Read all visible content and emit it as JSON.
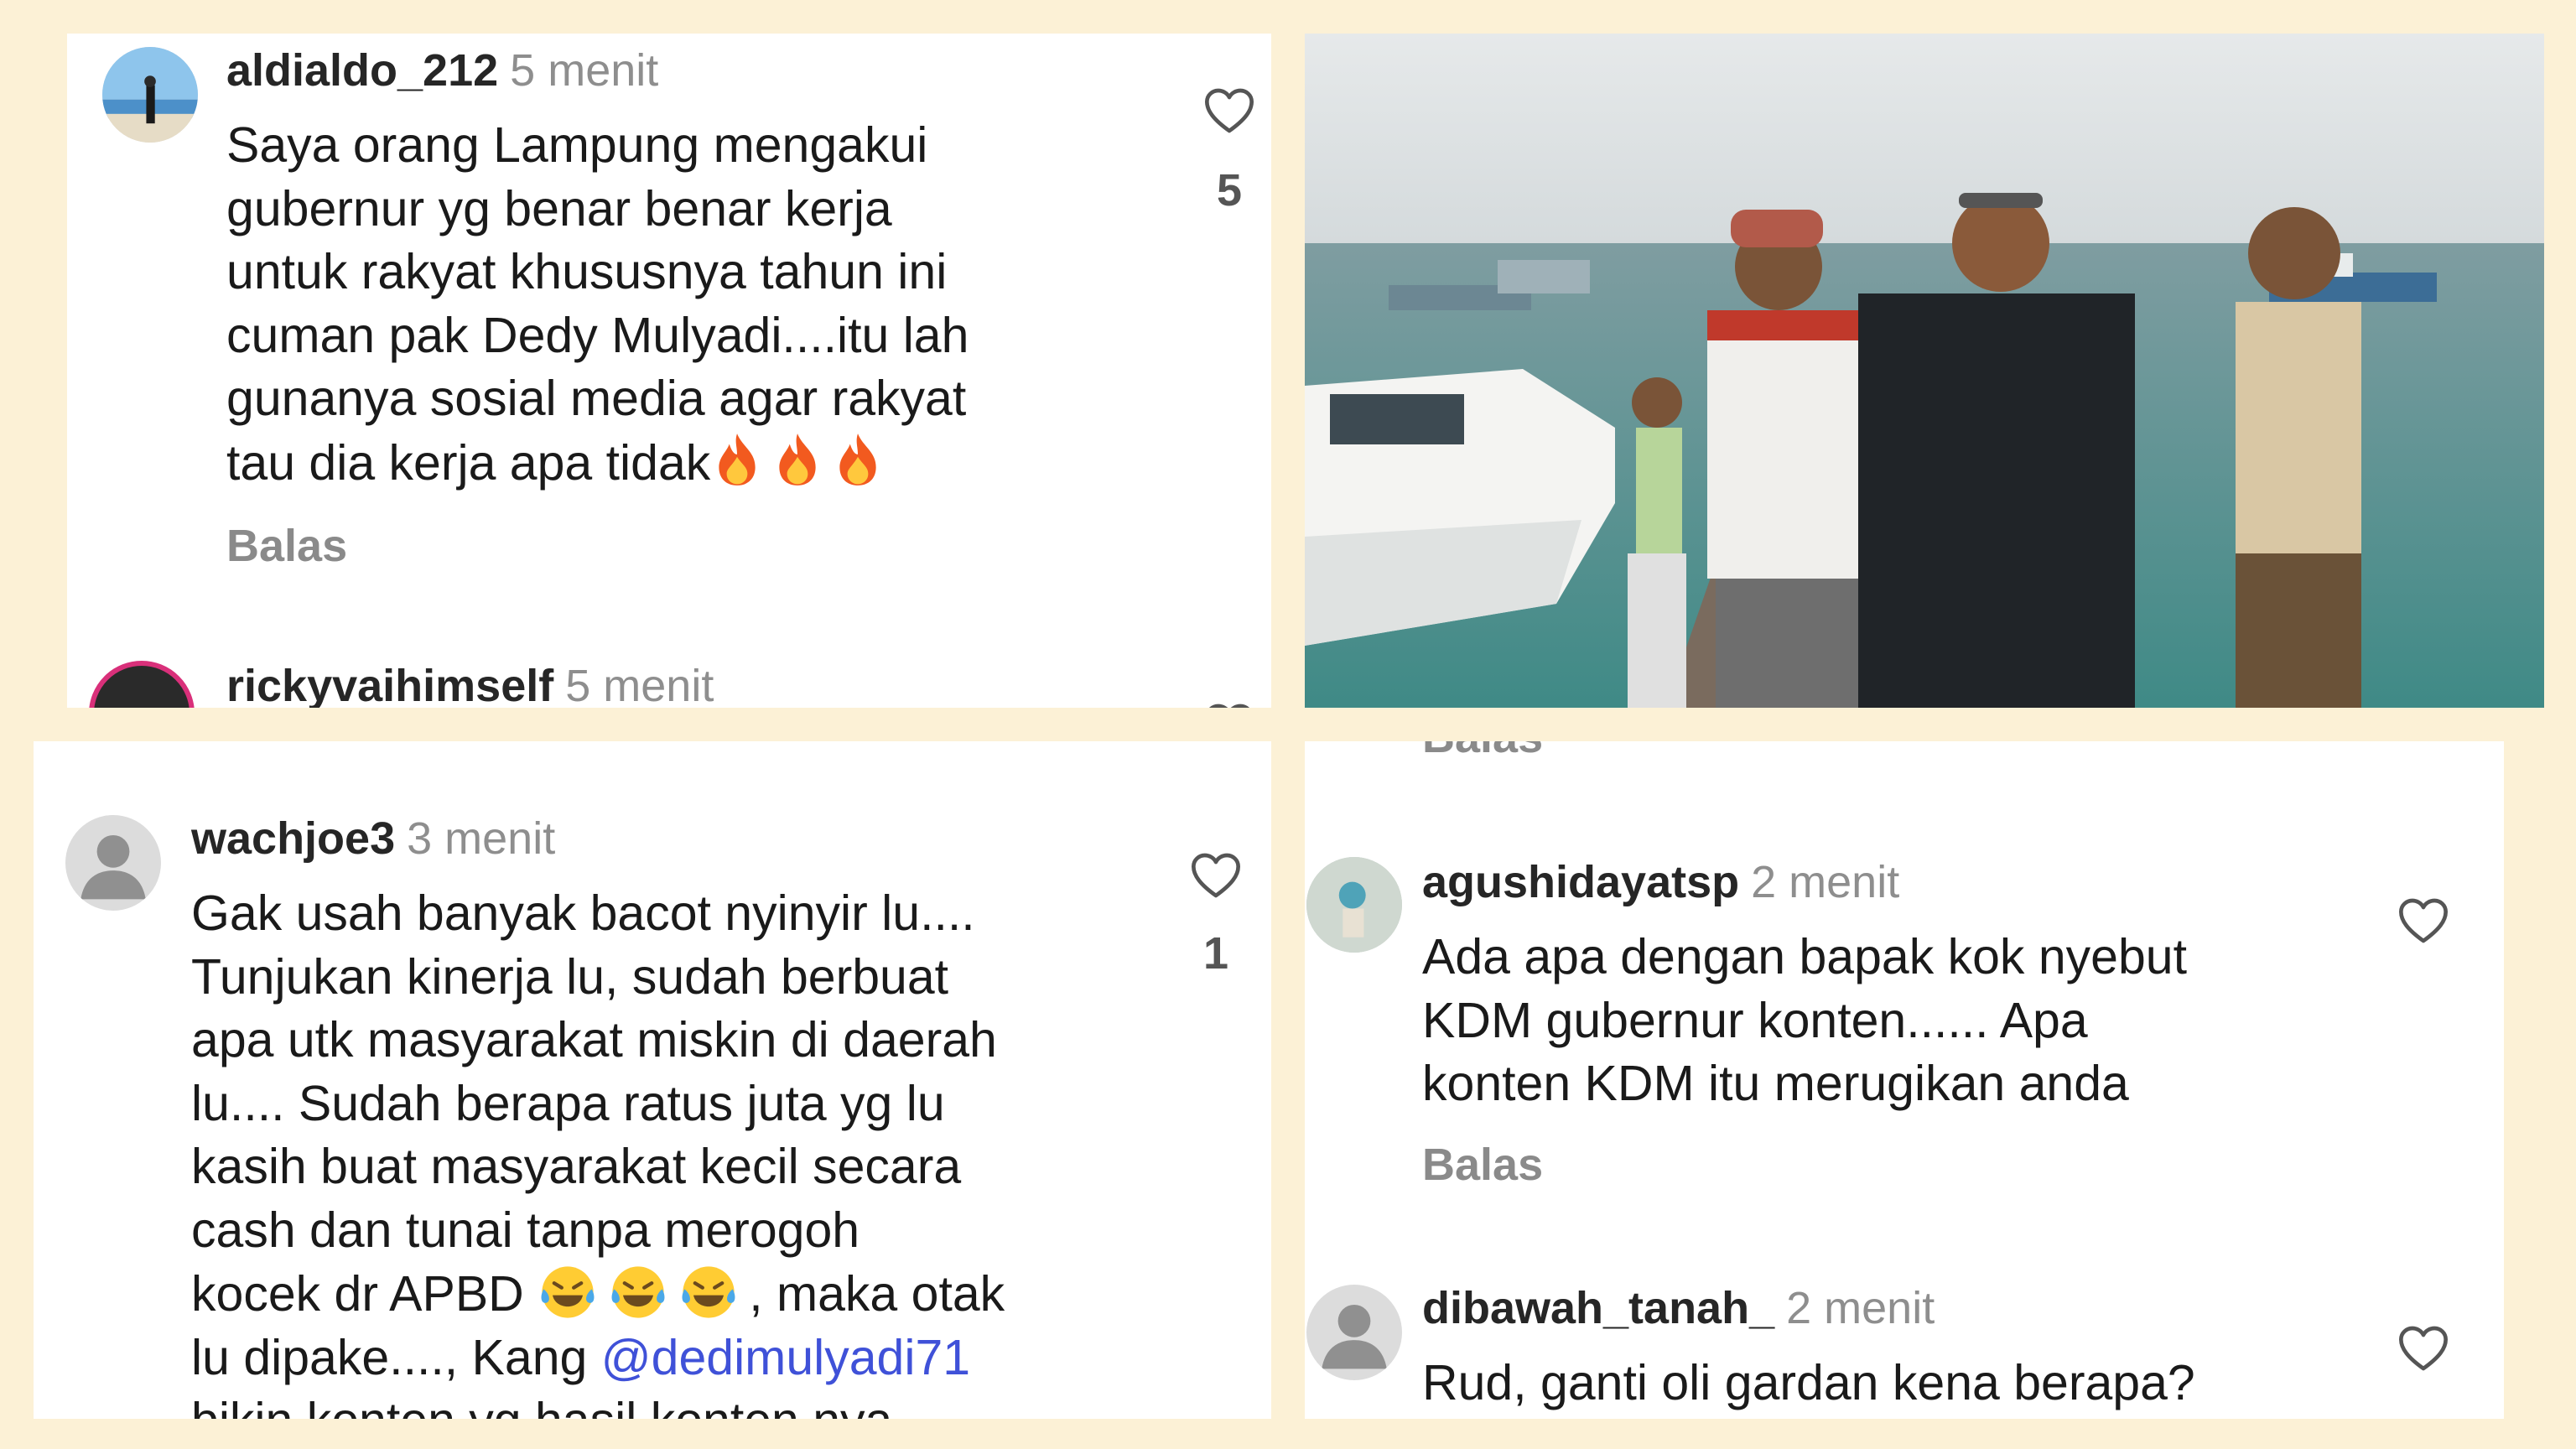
{
  "panel1": {
    "comment1": {
      "username": "aldialdo_212",
      "time": "5 menit",
      "text": "Saya orang Lampung mengakui\ngubernur yg benar benar kerja\nuntuk rakyat khususnya tahun ini\ncuman pak Dedy Mulyadi....itu lah\ngunanya sosial media agar rakyat\ntau dia kerja apa tidak",
      "emoji_icons": [
        "fire-emoji",
        "fire-emoji",
        "fire-emoji"
      ],
      "reply": "Balas",
      "likes": "5"
    },
    "comment2": {
      "username": "rickyvaihimself",
      "time": "5 menit"
    }
  },
  "panel3": {
    "comment": {
      "username": "wachjoe3",
      "time": "3 menit",
      "text_lines": [
        "Gak usah banyak bacot nyinyir lu....",
        "Tunjukan kinerja lu, sudah berbuat",
        "apa utk masyarakat miskin di daerah",
        "lu.... Sudah berapa ratus juta yg lu",
        "kasih buat masyarakat kecil secara",
        "cash dan tunai tanpa merogoh"
      ],
      "line7_before": "kocek dr APBD",
      "line7_after": ", maka otak",
      "line8_before": "lu dipake...., Kang",
      "mention": "@dedimulyadi71",
      "line9": "bikin konten yg hasil konten nya",
      "emoji_icons": [
        "laughing-tears-emoji",
        "laughing-tears-emoji",
        "laughing-tears-emoji"
      ],
      "likes": "1"
    }
  },
  "panel4": {
    "top_reply": "Balas",
    "comment1": {
      "username": "agushidayatsp",
      "time": "2 menit",
      "text": "Ada apa dengan bapak kok nyebut\nKDM gubernur konten...... Apa\nkonten KDM itu merugikan anda",
      "reply": "Balas"
    },
    "comment2": {
      "username": "dibawah_tanah_",
      "time": "2 menit",
      "text": "Rud, ganti oli gardan kena berapa?"
    }
  },
  "icons": {
    "like": "heart-outline-icon",
    "default_avatar": "default-avatar-icon"
  },
  "colors": {
    "background": "#fcf1d6",
    "mention": "#3f51d8",
    "secondary_text": "#8e8e8e"
  }
}
